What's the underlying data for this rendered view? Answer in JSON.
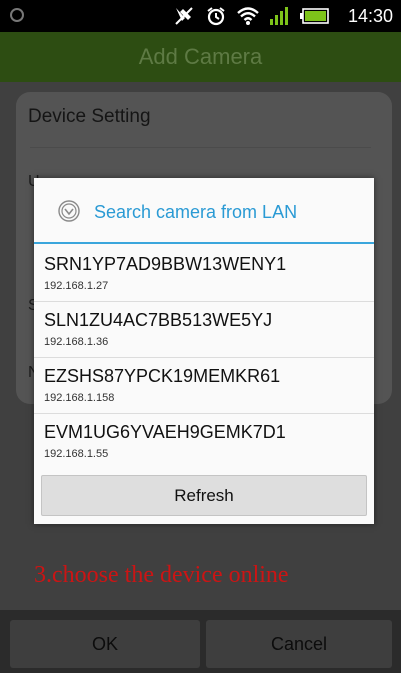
{
  "status_bar": {
    "time": "14:30",
    "icons": [
      "silent-icon",
      "alarm-icon",
      "wifi-icon",
      "signal-icon",
      "battery-icon"
    ]
  },
  "header": {
    "title": "Add Camera"
  },
  "background": {
    "section_title": "Device Setting",
    "partial_labels": [
      "U",
      "S",
      "N"
    ],
    "instruction": "3.choose the device online"
  },
  "dialog": {
    "icon": "search-circle-icon",
    "title": "Search camera from LAN",
    "devices": [
      {
        "name": "SRN1YP7AD9BBW13WENY1",
        "ip": "192.168.1.27"
      },
      {
        "name": "SLN1ZU4AC7BB513WE5YJ",
        "ip": "192.168.1.36"
      },
      {
        "name": "EZSHS87YPCK19MEMKR61",
        "ip": "192.168.1.158"
      },
      {
        "name": "EVM1UG6YVAEH9GEMK7D1",
        "ip": "192.168.1.55"
      }
    ],
    "refresh_label": "Refresh"
  },
  "buttons": {
    "ok": "OK",
    "cancel": "Cancel"
  },
  "colors": {
    "accent": "#3aa6dc",
    "instruction": "#cc1414",
    "header_green": "#2d4d12"
  }
}
